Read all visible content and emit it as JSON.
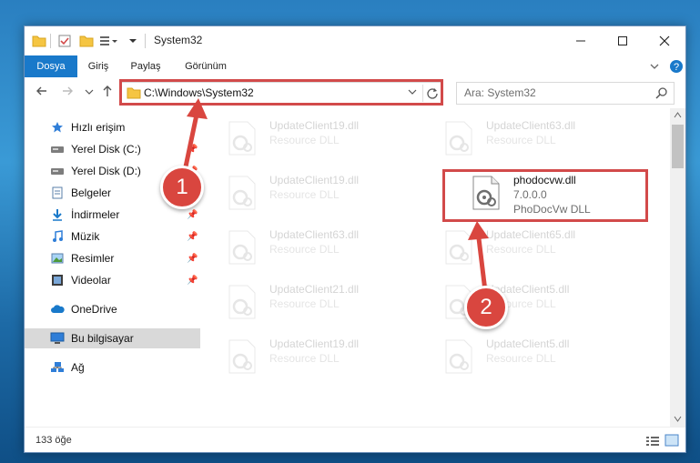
{
  "window": {
    "title": "System32"
  },
  "ribbon": {
    "tabs": [
      "Dosya",
      "Giriş",
      "Paylaş",
      "Görünüm"
    ]
  },
  "address": {
    "path": "C:\\Windows\\System32"
  },
  "search": {
    "placeholder": "Ara: System32"
  },
  "nav": {
    "items": [
      {
        "label": "Hızlı erişim",
        "icon": "star-icon"
      },
      {
        "label": "Yerel Disk (C:)",
        "icon": "drive-icon"
      },
      {
        "label": "Yerel Disk (D:)",
        "icon": "drive-icon"
      },
      {
        "label": "Belgeler",
        "icon": "document-icon"
      },
      {
        "label": "İndirmeler",
        "icon": "download-icon"
      },
      {
        "label": "Müzik",
        "icon": "music-icon"
      },
      {
        "label": "Resimler",
        "icon": "pictures-icon"
      },
      {
        "label": "Videolar",
        "icon": "video-icon"
      },
      {
        "label": "OneDrive",
        "icon": "cloud-icon"
      },
      {
        "label": "Bu bilgisayar",
        "icon": "computer-icon"
      },
      {
        "label": "Ağ",
        "icon": "network-icon"
      }
    ]
  },
  "files": [
    {
      "name": "UpdateClient19.dll",
      "sub1": "Resource DLL",
      "sub2": ""
    },
    {
      "name": "UpdateClient63.dll",
      "sub1": "Resource DLL",
      "sub2": ""
    },
    {
      "name": "UpdateClient19.dll",
      "sub1": "Resource DLL",
      "sub2": ""
    },
    {
      "name": "phodocvw.dll",
      "sub1": "7.0.0.0",
      "sub2": "PhoDocVw DLL"
    },
    {
      "name": "UpdateClient63.dll",
      "sub1": "Resource DLL",
      "sub2": ""
    },
    {
      "name": "UpdateClient65.dll",
      "sub1": "Resource DLL",
      "sub2": ""
    },
    {
      "name": "UpdateClient21.dll",
      "sub1": "Resource DLL",
      "sub2": ""
    },
    {
      "name": "UpdateClient5.dll",
      "sub1": "Resource DLL",
      "sub2": ""
    },
    {
      "name": "UpdateClient19.dll",
      "sub1": "Resource DLL",
      "sub2": ""
    },
    {
      "name": "UpdateClient5.dll",
      "sub1": "Resource DLL",
      "sub2": ""
    }
  ],
  "status": {
    "count": "133 öğe"
  },
  "callouts": [
    "1",
    "2"
  ],
  "colors": {
    "accent": "#1979ca",
    "highlight": "#d24a4a"
  }
}
